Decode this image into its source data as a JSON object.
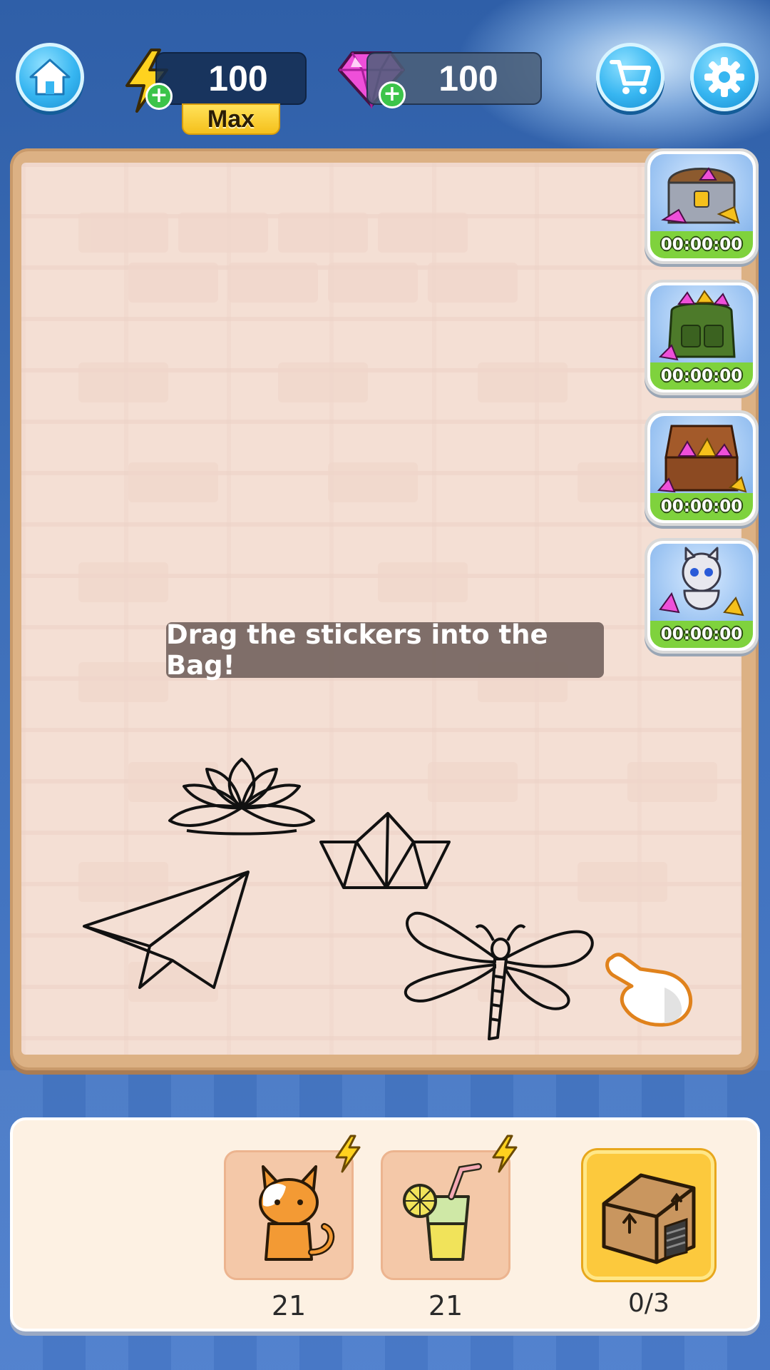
{
  "top_bar": {
    "energy_value": "100",
    "energy_badge": "Max",
    "gem_value": "100",
    "icons": {
      "home": "home-icon",
      "energy": "lightning-bolt-icon",
      "gem": "pink-gem-icon",
      "cart": "shopping-cart-icon",
      "settings": "gear-icon"
    }
  },
  "board": {
    "hint": "Drag the stickers into the Bag!",
    "stickers": [
      "lotus-outline",
      "paper-boat-outline",
      "paper-plane-outline",
      "dragonfly-outline"
    ],
    "tutorial_hand": "pointing-hand-icon"
  },
  "side_rewards": [
    {
      "name": "treasure-chest-reward",
      "timer": "00:00:00"
    },
    {
      "name": "backpack-reward",
      "timer": "00:00:00"
    },
    {
      "name": "suitcase-reward",
      "timer": "00:00:00"
    },
    {
      "name": "cat-with-gems-reward",
      "timer": "00:00:00"
    }
  ],
  "bottom_bar": {
    "items": [
      {
        "name": "cat-sticker-pack",
        "count": "21"
      },
      {
        "name": "lemonade-sticker-pack",
        "count": "21"
      }
    ],
    "bag": {
      "label_icon": "storage-house-icon",
      "count": "0/3"
    }
  },
  "colors": {
    "accent_blue": "#37b6f1",
    "energy_yellow": "#f5c01b",
    "gem_pink": "#e44cd8",
    "timer_green": "#7fd23d",
    "bag_yellow": "#fcc93d"
  }
}
